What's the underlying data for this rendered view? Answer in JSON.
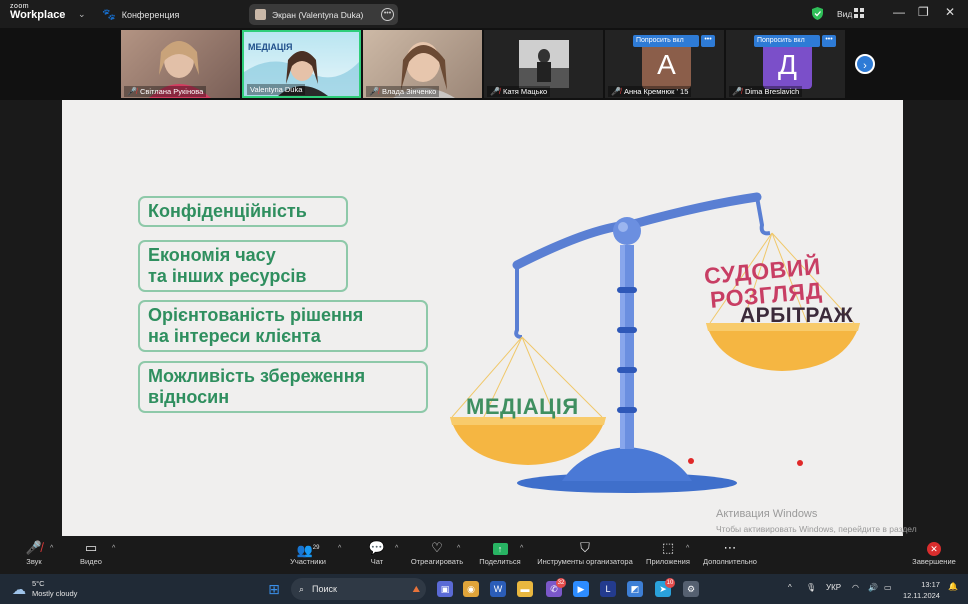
{
  "app": {
    "logo_top": "zoom",
    "logo_bottom": "Workplace",
    "conference_label": "Конференция",
    "screen_share_label": "Экран (Valentyna Duka)",
    "view_label": "Вид"
  },
  "participants": [
    {
      "name": "Світлана Рукінова",
      "muted": true
    },
    {
      "name": "Valentyna Duka",
      "muted": false,
      "active": true
    },
    {
      "name": "Влада Зінченко",
      "muted": true
    },
    {
      "name": "Катя Мацько",
      "muted": true
    },
    {
      "name": "Анна Кремнюк ' 15",
      "muted": true,
      "avatar_letter": "А",
      "avatar_color": "#8b5e4a",
      "badge": "Попросить вкл"
    },
    {
      "name": "Dima Breslavich",
      "muted": true,
      "avatar_letter": "Д",
      "avatar_color": "#7b4fc9",
      "badge": "Попросить вкл"
    }
  ],
  "thumb_text": "МЕДІАЦІЯ",
  "slide": {
    "benefits": [
      "Конфіденційність",
      "Економія часу\nта інших ресурсів",
      "Орієнтованість рішення\nна інтереси клієнта",
      "Можливість збереження\nвідносин"
    ],
    "left_pan_label": "МЕДІАЦІЯ",
    "right_label_1": "СУДОВИЙ",
    "right_label_2": "РОЗГЛЯД",
    "right_label_3": "АРБІТРАЖ",
    "colors": {
      "green": "#2f8f5f",
      "pink": "#c83e64",
      "dark": "#3b2a3a",
      "scale": "#5a7fd3",
      "pan": "#f5b642"
    }
  },
  "activation": {
    "title": "Активация Windows",
    "subtitle": "Чтобы активировать Windows, перейдите в раздел \"Параметры\"."
  },
  "toolbar": {
    "sound": "Звук",
    "video": "Видео",
    "participants": "Участники",
    "participants_count": "29",
    "chat": "Чат",
    "react": "Отреагировать",
    "share": "Поделиться",
    "host_tools": "Инструменты организатора",
    "apps": "Приложения",
    "more": "Дополнительно",
    "end": "Завершение"
  },
  "taskbar": {
    "temperature": "5°C",
    "weather": "Mostly cloudy",
    "search": "Поиск",
    "language": "УКР",
    "time": "13:17",
    "date": "12.11.2024",
    "viber_badge": "32",
    "telegram_badge": "10"
  }
}
